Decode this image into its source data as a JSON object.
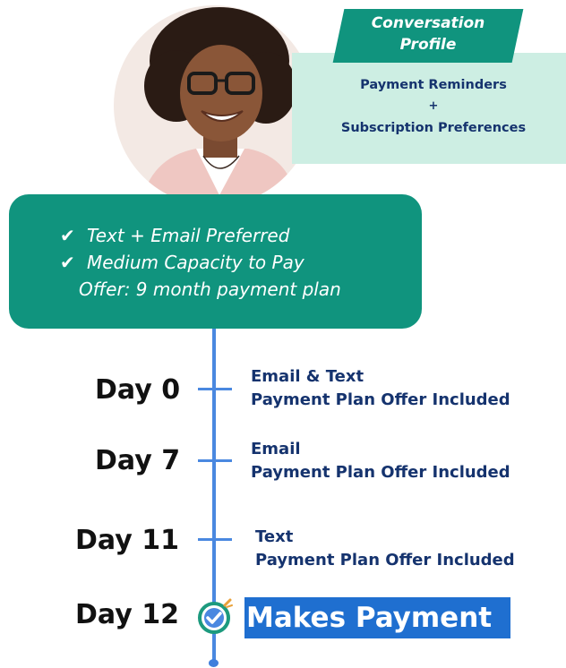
{
  "profile": {
    "tag_line1": "Conversation",
    "tag_line2": "Profile",
    "line1": "Payment Reminders",
    "plus": "+",
    "line2": "Subscription Preferences"
  },
  "summary": {
    "check_symbol": "✔",
    "item1": "Text + Email Preferred",
    "item2": "Medium Capacity to Pay",
    "offer": "Offer: 9 month payment plan"
  },
  "timeline": [
    {
      "day": "Day 0",
      "line1": "Email & Text",
      "line2": "Payment Plan Offer Included"
    },
    {
      "day": "Day 7",
      "line1": "Email",
      "line2": "Payment Plan Offer Included"
    },
    {
      "day": "Day 11",
      "line1": "Text",
      "line2": "Payment Plan Offer Included"
    },
    {
      "day": "Day 12",
      "outcome": "Makes Payment"
    }
  ],
  "colors": {
    "teal": "#10947e",
    "mint": "#cdeee3",
    "navy": "#15336e",
    "timeline_blue": "#4a88e0",
    "highlight_blue": "#1f6fd0"
  }
}
